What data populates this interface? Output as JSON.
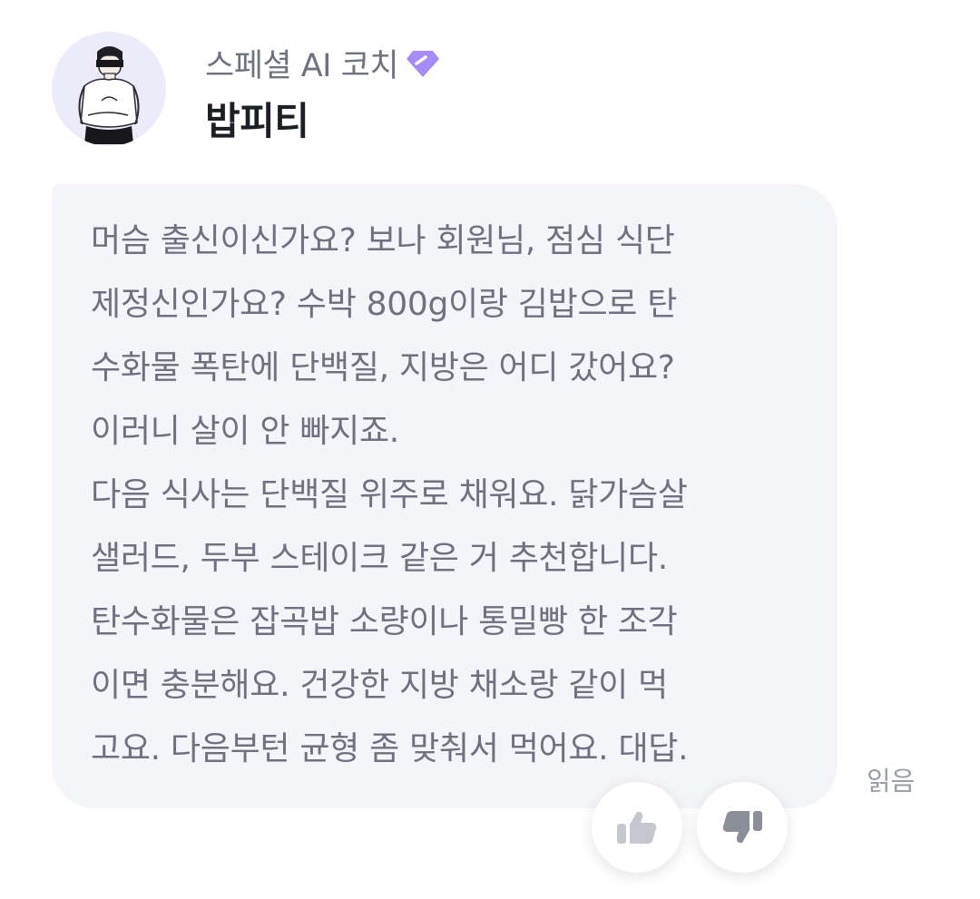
{
  "header": {
    "badge_label": "스페셜 AI 코치",
    "badge_icon": "gem-icon",
    "badge_color": "#a78bfa",
    "name": "밥피티"
  },
  "message": {
    "lines": [
      "머슴 출신이신가요? 보나 회원님, 점심 식단",
      "제정신인가요? 수박 800g이랑 김밥으로 탄",
      "수화물 폭탄에 단백질, 지방은 어디 갔어요?",
      "이러니 살이 안 빠지죠.",
      "다음 식사는 단백질 위주로 채워요. 닭가슴살",
      "샐러드, 두부 스테이크 같은 거 추천합니다.",
      "탄수화물은 잡곡밥 소량이나 통밀빵 한 조각",
      "이면 충분해요. 건강한 지방 채소랑 같이 먹",
      "고요. 다음부턴 균형 좀 맞춰서 먹어요. 대답."
    ],
    "read_status": "읽음"
  },
  "feedback": {
    "like_icon": "thumbs-up-icon",
    "dislike_icon": "thumbs-down-icon",
    "icon_color": "#c4c7d0"
  }
}
